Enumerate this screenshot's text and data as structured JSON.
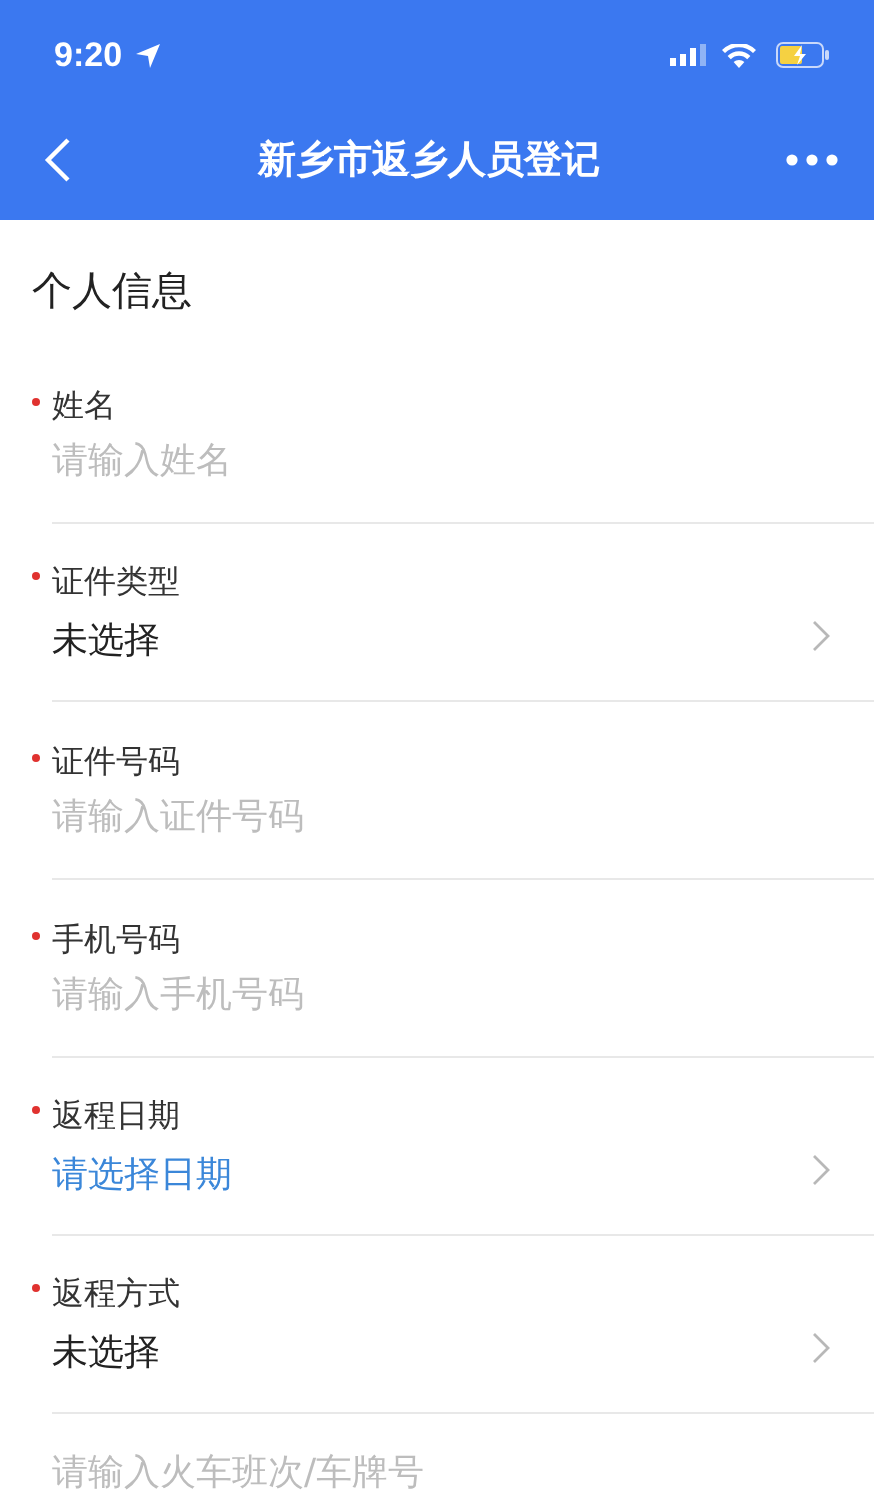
{
  "status_bar": {
    "time": "9:20"
  },
  "nav_bar": {
    "title": "新乡市返乡人员登记"
  },
  "section": {
    "title": "个人信息"
  },
  "fields": [
    {
      "kind": "input",
      "label": "姓名",
      "required": true,
      "placeholder": "请输入姓名"
    },
    {
      "kind": "select",
      "label": "证件类型",
      "required": true,
      "value": "未选择"
    },
    {
      "kind": "input",
      "label": "证件号码",
      "required": true,
      "placeholder": "请输入证件号码"
    },
    {
      "kind": "input",
      "label": "手机号码",
      "required": true,
      "placeholder": "请输入手机号码"
    },
    {
      "kind": "date",
      "label": "返程日期",
      "required": true,
      "value": "请选择日期"
    },
    {
      "kind": "select",
      "label": "返程方式",
      "required": true,
      "value": "未选择"
    },
    {
      "kind": "input",
      "placeholder": "请输入火车班次/车牌号"
    }
  ]
}
